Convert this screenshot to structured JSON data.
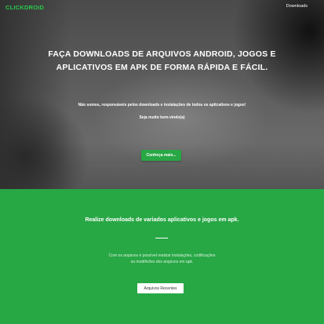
{
  "navbar": {
    "brand": "CLICKDROID",
    "link": "Downloads"
  },
  "hero": {
    "title_line1": "FAÇA DOWNLOADS DE ARQUIVOS ANDROID, JOGOS E",
    "title_line2": "APLICATIVOS EM APK DE FORMA RÁPIDA E FÁCIL.",
    "text1": "Não somos, responsáveis pelos downloads e instalações de todos os aplicativos e jogos!",
    "text2": "Seja muito bem-vindo(a)",
    "button": "Conheça mais..."
  },
  "about": {
    "title": "Realize downloads de variados aplicativos e jogos em apk.",
    "text_line1": "Com os arquivos é possível realizar instalações, codificações",
    "text_line2": "ou modificões dos arquivos em apk.",
    "button": "Arquivos Recentes"
  },
  "colors": {
    "accent": "#28a745",
    "brand": "#28c94a"
  }
}
